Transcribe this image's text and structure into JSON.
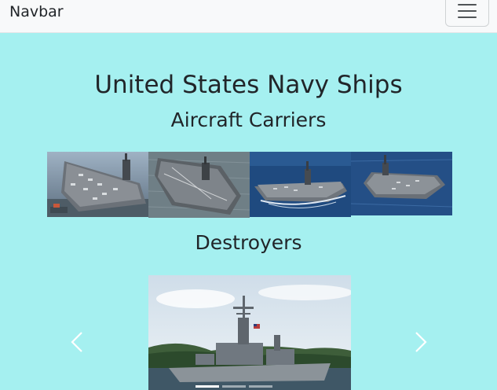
{
  "navbar": {
    "brand": "Navbar",
    "toggler_icon": "hamburger-menu-icon"
  },
  "main": {
    "title": "United States Navy Ships",
    "sections": [
      {
        "heading": "Aircraft Carriers",
        "images": [
          {
            "depicts": "aircraft-carrier-docked"
          },
          {
            "depicts": "aircraft-carrier-at-sea"
          },
          {
            "depicts": "aircraft-carrier-underway"
          },
          {
            "depicts": "aircraft-carrier-open-ocean"
          }
        ]
      },
      {
        "heading": "Destroyers",
        "carousel": {
          "active_slide": 0,
          "slide_count": 3,
          "prev_icon": "chevron-left-icon",
          "next_icon": "chevron-right-icon"
        }
      }
    ]
  },
  "colors": {
    "page_background": "#a5f0f0",
    "navbar_background": "#f8f9fa",
    "text": "#212529"
  }
}
